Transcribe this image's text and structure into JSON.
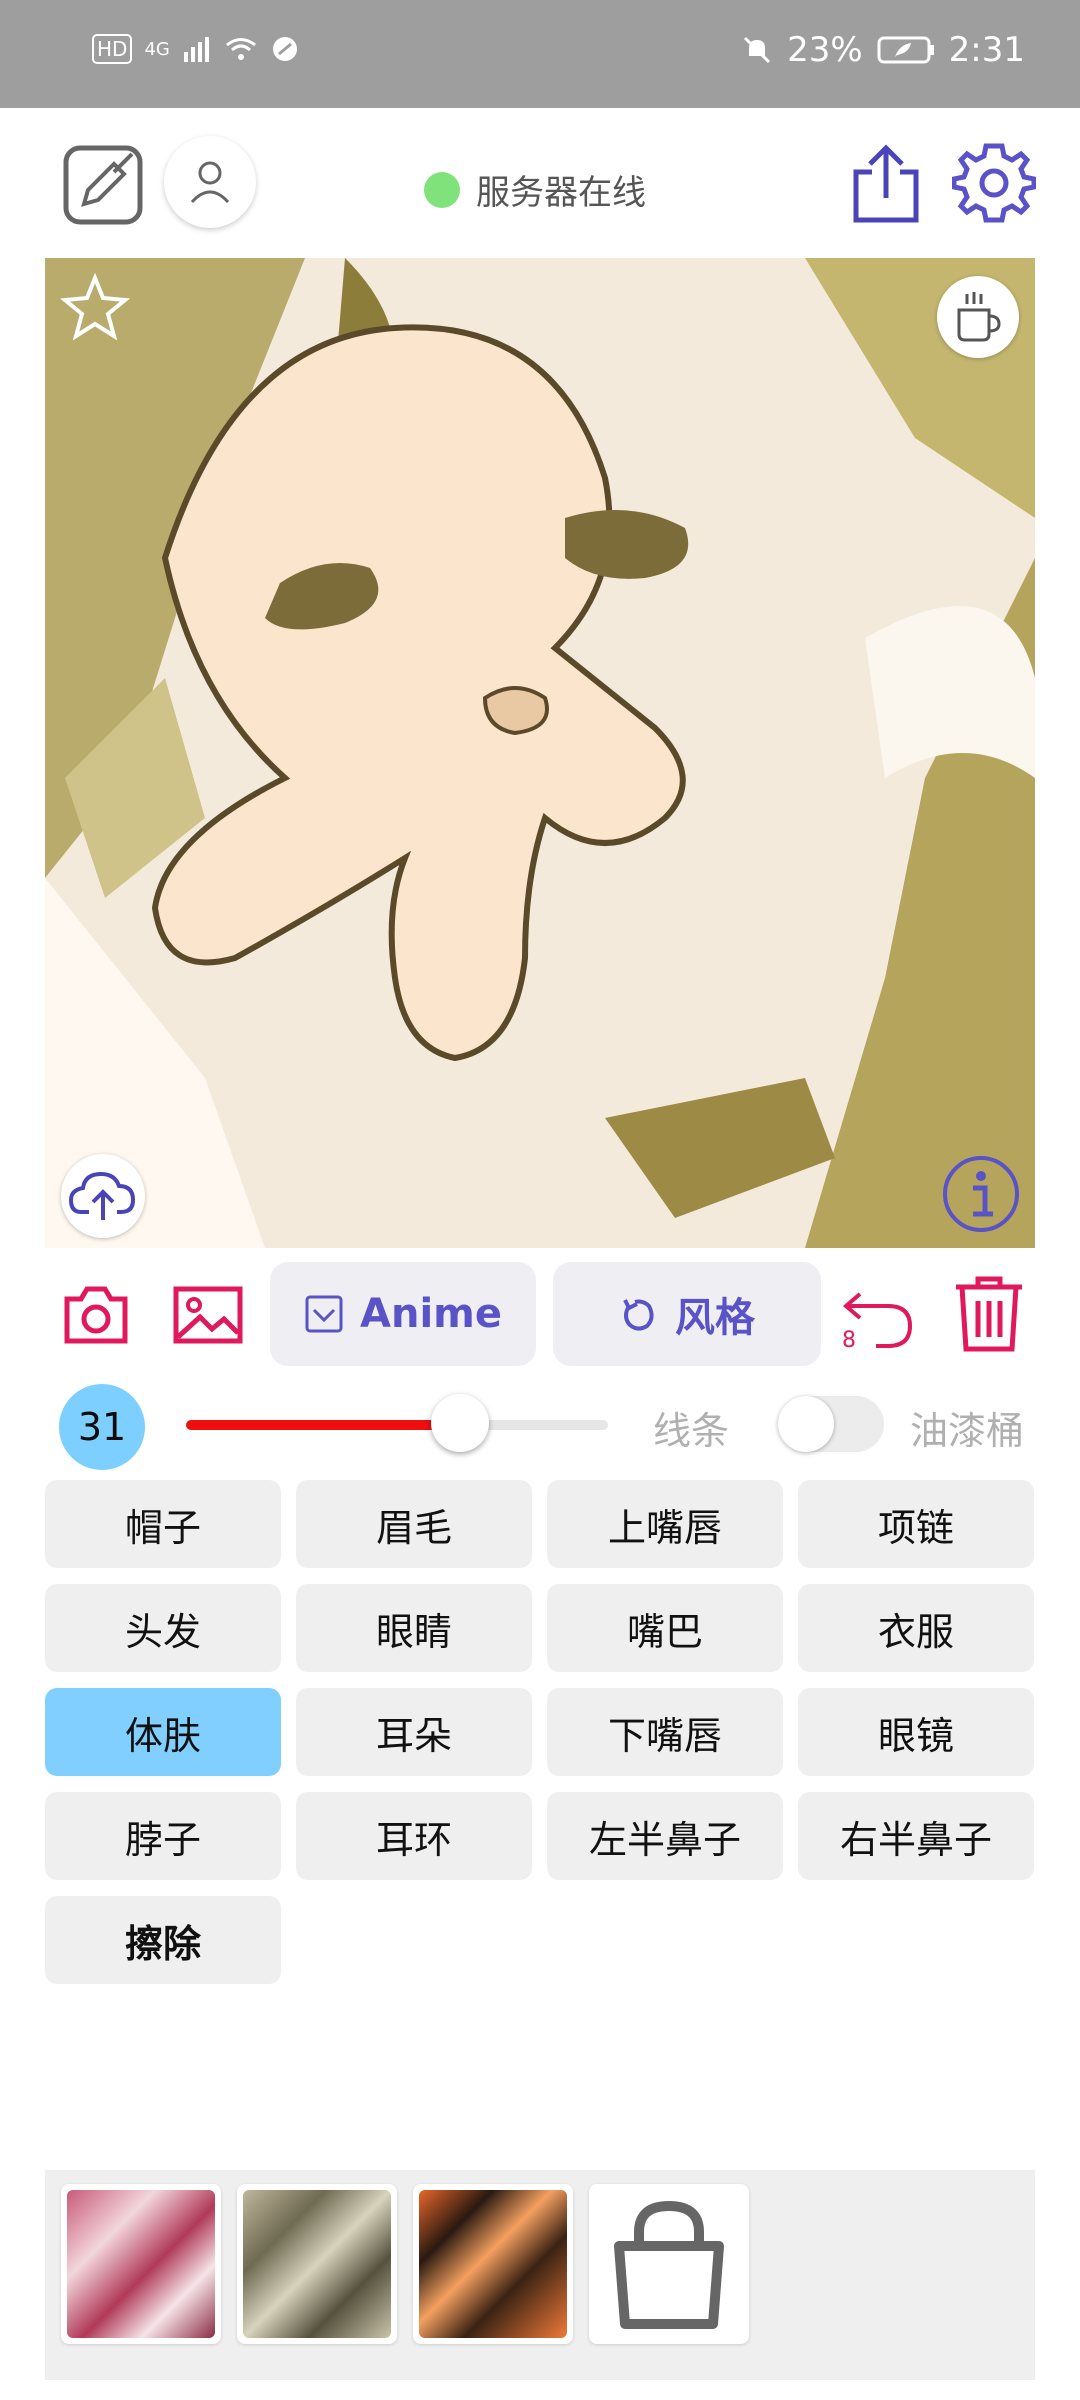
{
  "status_bar": {
    "time": "2:31",
    "battery": "23%",
    "network": "4G",
    "hd": "HD"
  },
  "header": {
    "server_status": "服务器在线",
    "status_color": "#7fe27a",
    "accent": "#5a53c7"
  },
  "toolbar": {
    "anime_label": "Anime",
    "style_label": "风格",
    "undo_count": "8",
    "action_color": "#e0185c"
  },
  "brush": {
    "size": "31",
    "slider_fraction": 0.65,
    "line_label": "线条",
    "bucket_label": "油漆桶",
    "bucket_enabled": false
  },
  "parts": [
    {
      "label": "帽子",
      "selected": false
    },
    {
      "label": "眉毛",
      "selected": false
    },
    {
      "label": "上嘴唇",
      "selected": false
    },
    {
      "label": "项链",
      "selected": false
    },
    {
      "label": "头发",
      "selected": false
    },
    {
      "label": "眼睛",
      "selected": false
    },
    {
      "label": "嘴巴",
      "selected": false
    },
    {
      "label": "衣服",
      "selected": false
    },
    {
      "label": "体肤",
      "selected": true
    },
    {
      "label": "耳朵",
      "selected": false
    },
    {
      "label": "下嘴唇",
      "selected": false
    },
    {
      "label": "眼镜",
      "selected": false
    },
    {
      "label": "脖子",
      "selected": false
    },
    {
      "label": "耳环",
      "selected": false
    },
    {
      "label": "左半鼻子",
      "selected": false
    },
    {
      "label": "右半鼻子",
      "selected": false
    },
    {
      "label": "擦除",
      "selected": false
    }
  ],
  "icons": {
    "edit": "edit-square-icon",
    "user": "user-icon",
    "share": "share-icon",
    "settings": "gear-icon",
    "star": "star-icon",
    "coffee": "coffee-icon",
    "upload": "cloud-upload-icon",
    "info": "info-icon",
    "camera": "camera-icon",
    "gallery": "image-icon",
    "undo": "undo-icon",
    "delete": "trash-icon",
    "store": "shopping-bag-icon"
  }
}
